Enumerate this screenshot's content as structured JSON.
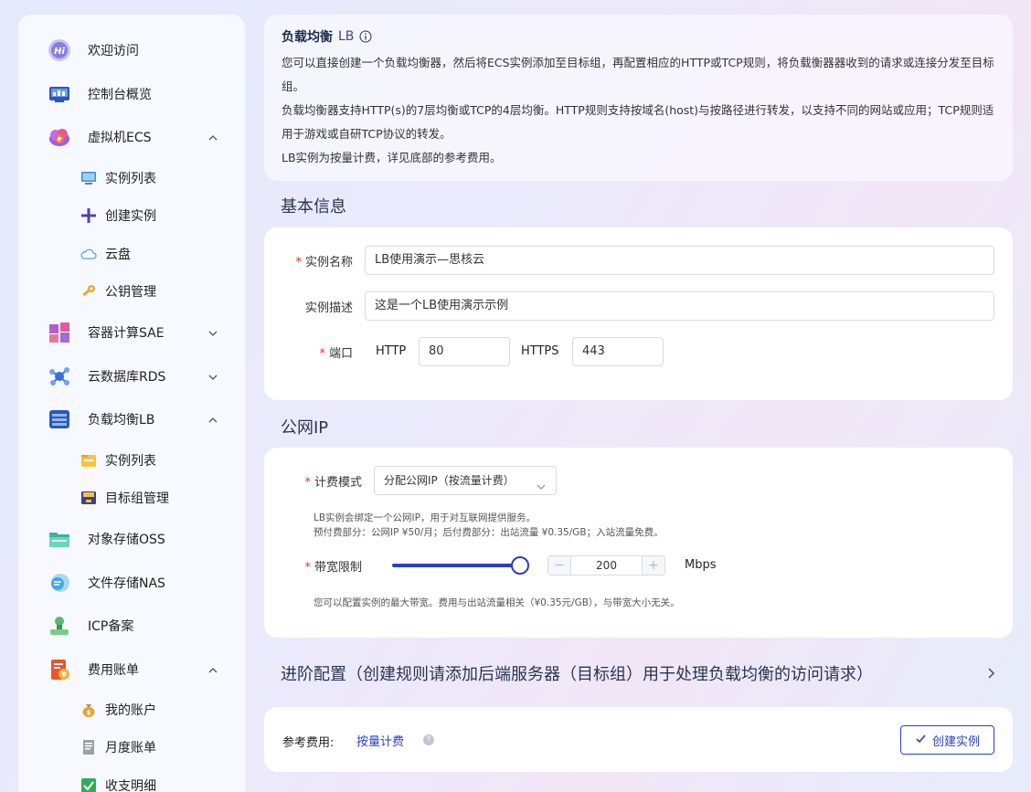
{
  "sidebar": {
    "items": [
      {
        "label": "欢迎访问",
        "icon": "hi-badge-icon"
      },
      {
        "label": "控制台概览",
        "icon": "dashboard-icon"
      },
      {
        "label": "虚拟机ECS",
        "icon": "cloud-server-icon"
      },
      {
        "label": "容器计算SAE",
        "icon": "container-icon"
      },
      {
        "label": "云数据库RDS",
        "icon": "database-icon"
      },
      {
        "label": "负载均衡LB",
        "icon": "load-balancer-icon"
      },
      {
        "label": "对象存储OSS",
        "icon": "folder-storage-icon"
      },
      {
        "label": "文件存储NAS",
        "icon": "nas-icon"
      },
      {
        "label": "ICP备案",
        "icon": "stamp-icon"
      },
      {
        "label": "费用账单",
        "icon": "bill-icon"
      }
    ],
    "ecs_sub": [
      "实例列表",
      "创建实例",
      "云盘",
      "公钥管理"
    ],
    "lb_sub": [
      "实例列表",
      "目标组管理"
    ],
    "bill_sub": [
      "我的账户",
      "月度账单",
      "收支明细"
    ]
  },
  "intro": {
    "title": "负载均衡",
    "title_suffix": "LB",
    "p1": "您可以直接创建一个负载均衡器，然后将ECS实例添加至目标组，再配置相应的HTTP或TCP规则，将负载衡器器收到的请求或连接分发至目标组。",
    "p2": "负载均衡器支持HTTP(s)的7层均衡或TCP的4层均衡。HTTP规则支持按域名(host)与按路径进行转发，以支持不同的网站或应用；TCP规则适用于游戏或自研TCP协议的转发。",
    "p3": "LB实例为按量计费，详见底部的参考费用。"
  },
  "basic": {
    "section_title": "基本信息",
    "name_label": "实例名称",
    "name_value": "LB使用演示—思核云",
    "desc_label": "实例描述",
    "desc_value": "这是一个LB使用演示示例",
    "port_label": "端口",
    "http_label": "HTTP",
    "http_value": "80",
    "https_label": "HTTPS",
    "https_value": "443"
  },
  "public_ip": {
    "section_title": "公网IP",
    "billing_label": "计费模式",
    "billing_value": "分配公网IP（按流量计费）",
    "hint1": "LB实例会绑定一个公网IP，用于对互联网提供服务。",
    "hint2": "预付费部分：公网IP ¥50/月；后付费部分：出站流量 ¥0.35/GB；入站流量免费。",
    "bandwidth_label": "带宽限制",
    "bandwidth_value": "200",
    "bandwidth_level": 1.0,
    "bandwidth_unit": "Mbps",
    "hint3": "您可以配置实例的最大带宽。费用与出站流量相关（¥0.35元/GB），与带宽大小无关。"
  },
  "advanced": {
    "label": "进阶配置（创建规则请添加后端服务器（目标组）用于处理负载均衡的访问请求）"
  },
  "footer": {
    "ref_label": "参考费用:",
    "ref_link": "按量计费",
    "create_label": "创建实例"
  },
  "colors": {
    "accent": "#2c3ec2",
    "required": "#e0302e"
  }
}
